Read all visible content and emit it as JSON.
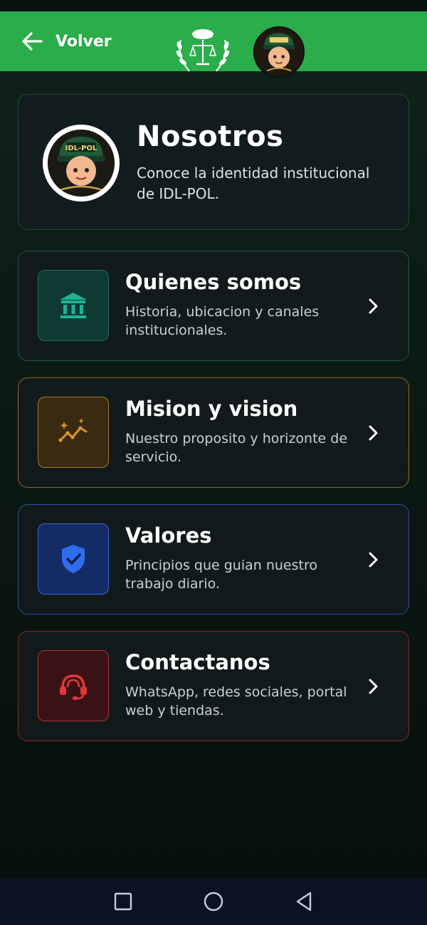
{
  "header": {
    "back_label": "Volver",
    "emblem_icon": "police-laurel-scales-emblem",
    "avatar_icon": "idl-pol-mascot-avatar"
  },
  "hero": {
    "title": "Nosotros",
    "subtitle": "Conoce la identidad institucional de IDL-POL.",
    "avatar_cap_text": "IDL-POL"
  },
  "menu": [
    {
      "title": "Quienes somos",
      "description": "Historia, ubicacion y canales institucionales.",
      "icon": "institution-building-icon",
      "accent": "#1f9e86"
    },
    {
      "title": "Mision y vision",
      "description": "Nuestro proposito y horizonte de servicio.",
      "icon": "trend-sparkle-icon",
      "accent": "#c88a2e"
    },
    {
      "title": "Valores",
      "description": "Principios que guian nuestro trabajo diario.",
      "icon": "shield-check-icon",
      "accent": "#2f6df0"
    },
    {
      "title": "Contactanos",
      "description": "WhatsApp, redes sociales, portal web y tiendas.",
      "icon": "headset-support-icon",
      "accent": "#d93434"
    }
  ],
  "colors": {
    "header_green": "#2bad4b",
    "background": "#0b1a14",
    "nav_bar": "#0a1224"
  }
}
